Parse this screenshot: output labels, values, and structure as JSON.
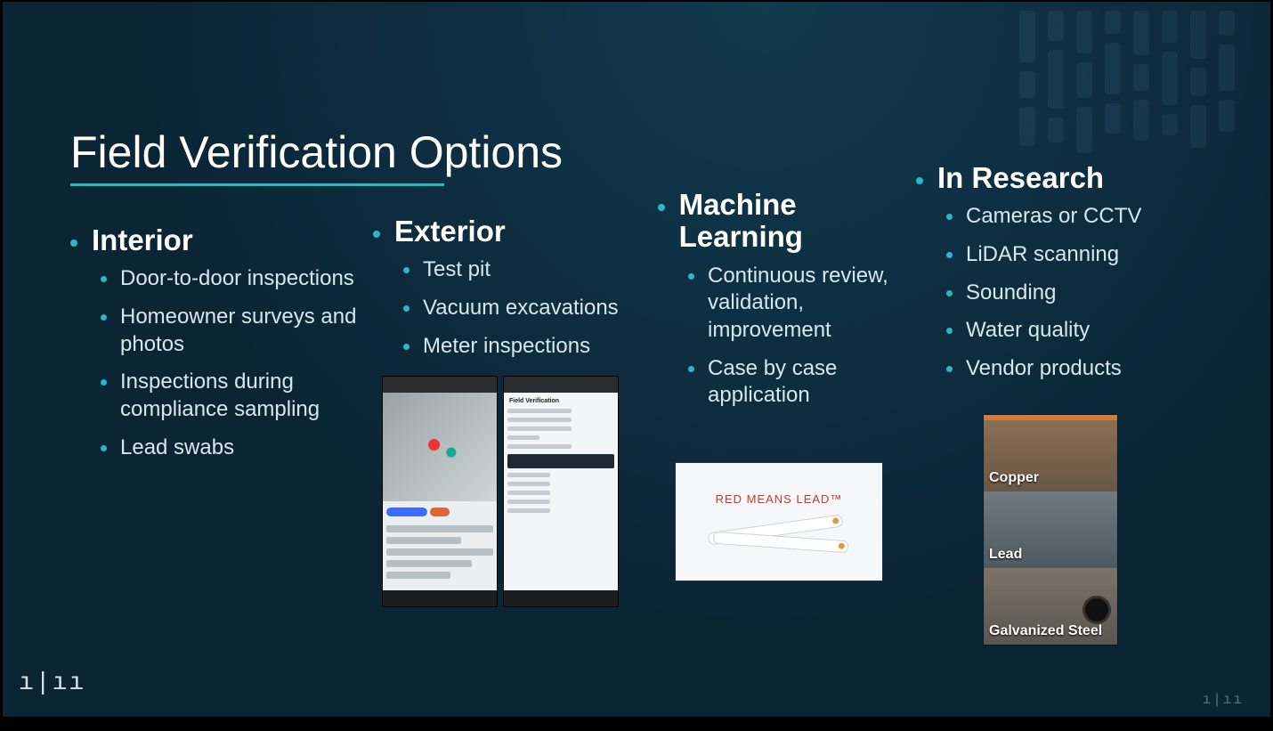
{
  "slide": {
    "title": "Field Verification Options"
  },
  "sections": {
    "interior": {
      "heading": "Interior",
      "items": [
        "Door-to-door inspections",
        "Homeowner surveys and photos",
        "Inspections during compliance sampling",
        "Lead swabs"
      ]
    },
    "exterior": {
      "heading": "Exterior",
      "items": [
        "Test pit",
        "Vacuum excavations",
        "Meter inspections"
      ],
      "form_header": "Field Verification"
    },
    "ml": {
      "heading": "Machine Learning",
      "items": [
        "Continuous review, validation, improvement",
        "Case by case application"
      ],
      "image_tag": "RED MEANS LEAD™"
    },
    "research": {
      "heading": "In Research",
      "items": [
        "Cameras or CCTV",
        "LiDAR scanning",
        "Sounding",
        "Water quality",
        "Vendor products"
      ],
      "materials": {
        "copper": "Copper",
        "lead": "Lead",
        "galv": "Galvanized Steel"
      }
    }
  }
}
